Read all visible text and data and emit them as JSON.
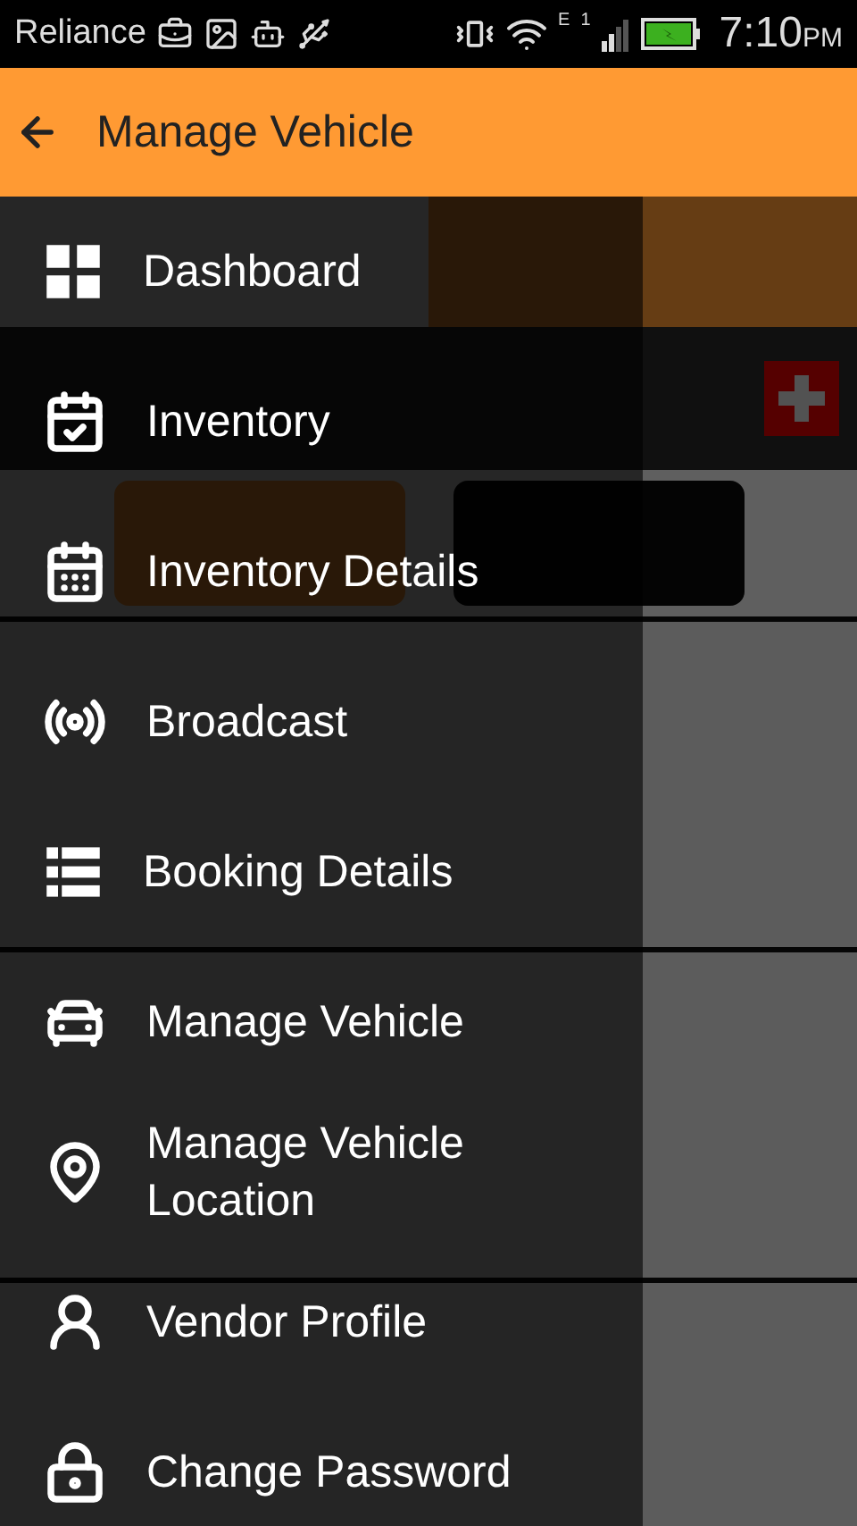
{
  "status_bar": {
    "carrier": "Reliance",
    "network_type": "E",
    "sim_slot": "1",
    "time": "7:10",
    "meridiem": "PM"
  },
  "app_bar": {
    "title": "Manage Vehicle"
  },
  "drawer": {
    "items": [
      {
        "label": "Dashboard"
      },
      {
        "label": "Inventory"
      },
      {
        "label": "Inventory Details"
      },
      {
        "label": "Broadcast"
      },
      {
        "label": "Booking Details"
      },
      {
        "label": "Manage Vehicle"
      },
      {
        "label": "Manage Vehicle Location"
      },
      {
        "label": "Vendor Profile"
      },
      {
        "label": "Change Password"
      }
    ]
  }
}
